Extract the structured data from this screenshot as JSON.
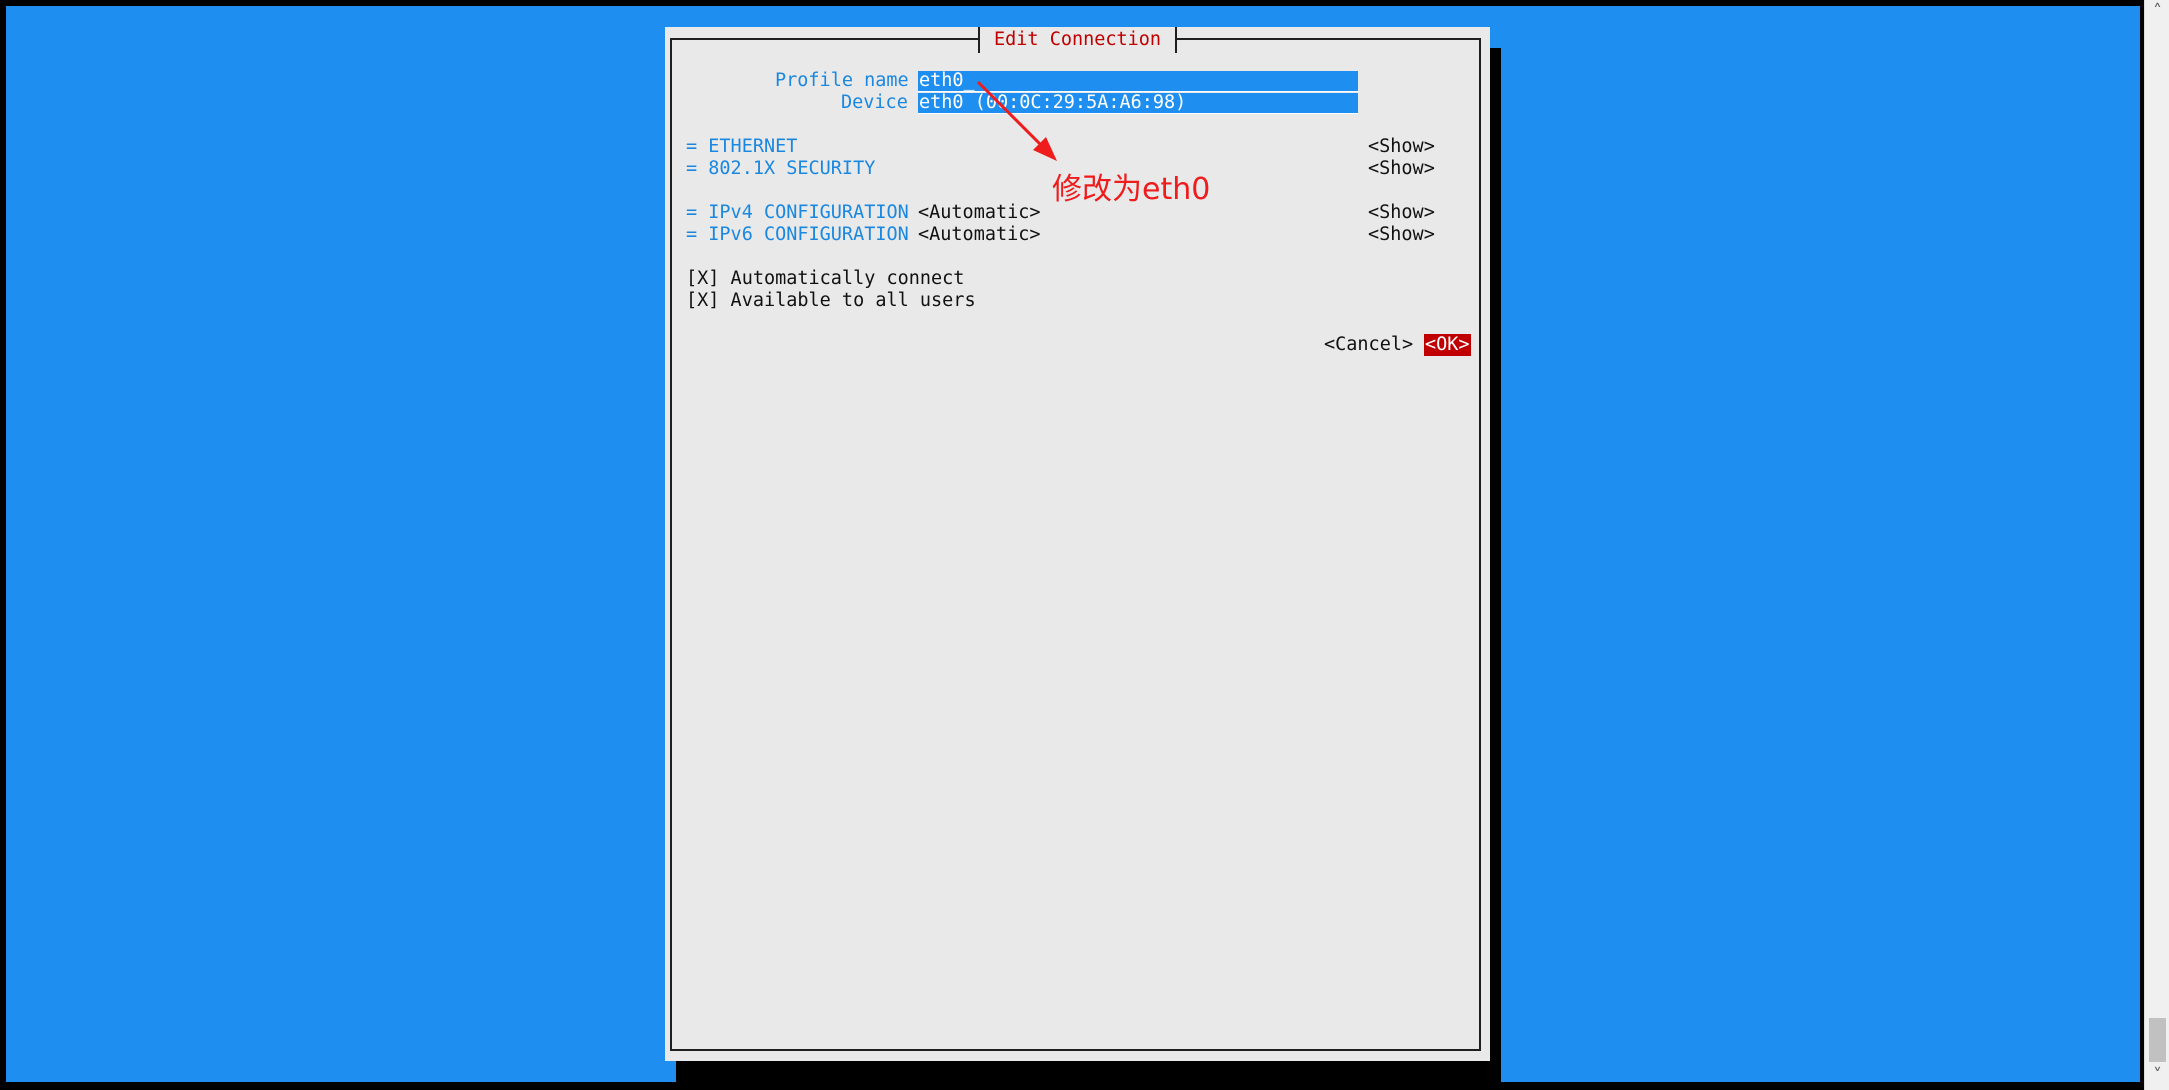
{
  "dialog": {
    "title": "Edit Connection",
    "profile_name_label": "Profile name",
    "profile_name_value": "eth0_",
    "device_label": "Device",
    "device_value": "eth0 (00:0C:29:5A:A6:98)",
    "sections": [
      {
        "label": "= ETHERNET",
        "value": "",
        "action": "<Show>"
      },
      {
        "label": "= 802.1X SECURITY",
        "value": "",
        "action": "<Show>"
      },
      {
        "label": "= IPv4 CONFIGURATION",
        "value": "<Automatic>",
        "action": "<Show>"
      },
      {
        "label": "= IPv6 CONFIGURATION",
        "value": "<Automatic>",
        "action": "<Show>"
      }
    ],
    "checkboxes": [
      {
        "label": "[X] Automatically connect"
      },
      {
        "label": "[X] Available to all users"
      }
    ],
    "cancel_label": "<Cancel>",
    "ok_label": "<OK>"
  },
  "annotation": {
    "text": "修改为eth0",
    "color": "#ee1c1c"
  },
  "scrollbar": {
    "up_arrow": "˄",
    "down_arrow": "˅"
  },
  "colors": {
    "background": "#1e8ff0",
    "dialog": "#e9e9e9",
    "accent_red": "#c00000",
    "label_blue": "#1a87e0"
  }
}
